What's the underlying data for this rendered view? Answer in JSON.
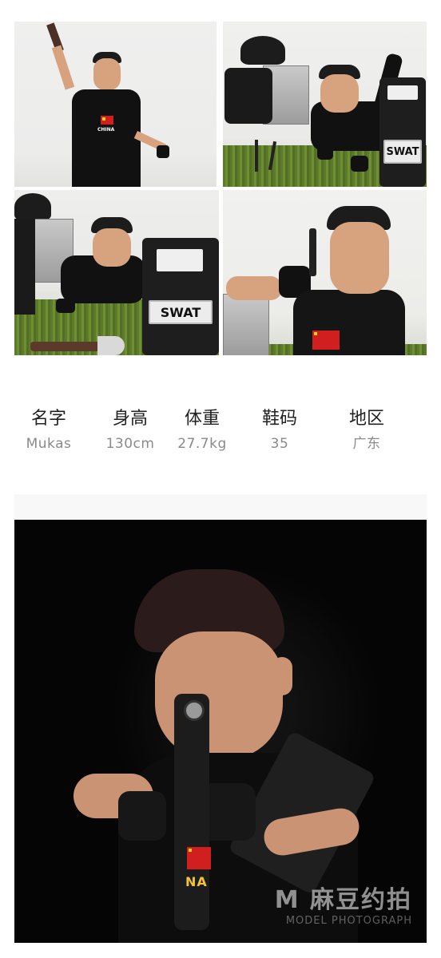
{
  "photo_grid": {
    "shield_text": "SWAT",
    "shirt_text": "CHINA"
  },
  "profile": {
    "fields": [
      {
        "label": "名字",
        "value": "Mukas"
      },
      {
        "label": "身高",
        "value": "130cm"
      },
      {
        "label": "体重",
        "value": "27.7kg"
      },
      {
        "label": "鞋码",
        "value": "35"
      },
      {
        "label": "地区",
        "value": "广东"
      }
    ]
  },
  "hero": {
    "shirt_text": "NA",
    "watermark": {
      "logo": "M",
      "text": "麻豆约拍",
      "subtext": "MODEL PHOTOGRAPH"
    }
  }
}
